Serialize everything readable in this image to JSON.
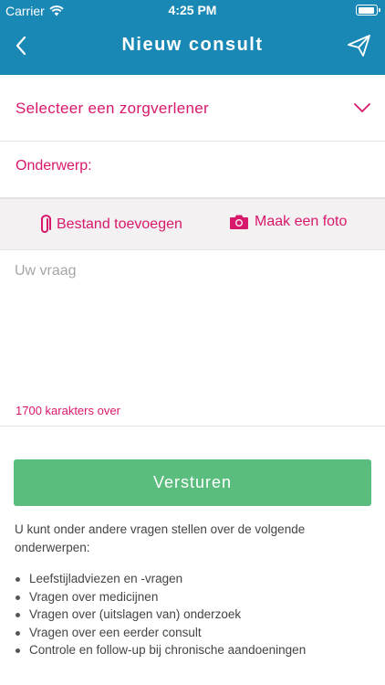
{
  "status_bar": {
    "carrier": "Carrier",
    "time": "4:25 PM"
  },
  "nav": {
    "title": "Nieuw consult",
    "back_icon": "chevron-left-icon",
    "send_icon": "paper-plane-icon"
  },
  "caregiver_select": {
    "label": "Selecteer een zorgverlener",
    "icon": "chevron-down-icon"
  },
  "subject": {
    "label": "Onderwerp:",
    "value": ""
  },
  "attachments": {
    "file_label": "Bestand toevoegen",
    "file_icon": "paperclip-icon",
    "photo_label": "Maak een foto",
    "photo_icon": "camera-icon"
  },
  "question": {
    "placeholder": "Uw vraag",
    "value": "",
    "chars_left": "1700 karakters over"
  },
  "submit": {
    "label": "Versturen"
  },
  "info": {
    "intro": "U kunt onder andere vragen stellen over de volgende onderwerpen:",
    "topics": [
      "Leefstijladviezen en -vragen",
      "Vragen over medicijnen",
      "Vragen over (uitslagen van) onderzoek",
      "Vragen over een eerder consult",
      "Controle en follow-up bij chronische aandoeningen"
    ]
  },
  "colors": {
    "header": "#1a88b5",
    "accent": "#d8186b",
    "submit": "#5bbd7d",
    "attach_bg": "#f3f1f2"
  }
}
